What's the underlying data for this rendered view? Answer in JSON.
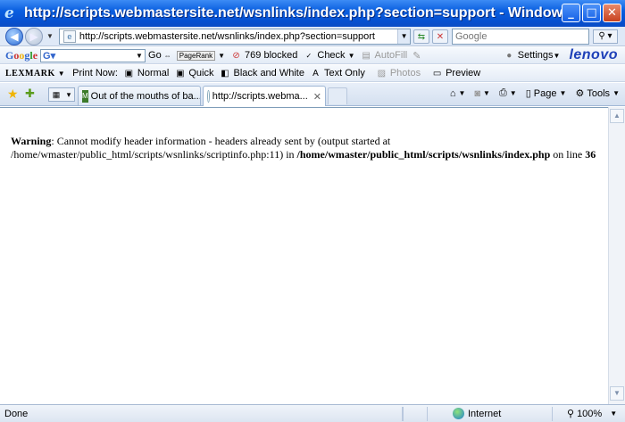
{
  "window": {
    "title": "http://scripts.webmastersite.net/wsnlinks/index.php?section=support - Windows In..."
  },
  "address_bar": {
    "url": "http://scripts.webmastersite.net/wsnlinks/index.php?section=support",
    "search_placeholder": "Google"
  },
  "google_toolbar": {
    "logo": "Google",
    "go_label": "Go",
    "pagerank_label": "PageRank",
    "blocked_label": "769 blocked",
    "check_label": "Check",
    "autofill_label": "AutoFill",
    "settings_label": "Settings",
    "brand": "lenovo"
  },
  "lexmark_toolbar": {
    "logo": "LEXMARK",
    "print_now_label": "Print Now:",
    "normal_label": "Normal",
    "quick_label": "Quick",
    "black_white_label": "Black and White",
    "text_only_label": "Text Only",
    "photos_label": "Photos",
    "preview_label": "Preview"
  },
  "tabs": [
    {
      "label": "Out of the mouths of ba...",
      "active": false
    },
    {
      "label": "http://scripts.webma...",
      "active": true
    }
  ],
  "command_bar": {
    "page_label": "Page",
    "tools_label": "Tools"
  },
  "content": {
    "warning_label": "Warning",
    "message_part1": ": Cannot modify header information - headers already sent by (output started at /home/wmaster/public_html/scripts/wsnlinks/scriptinfo.php:11) in ",
    "file_path": "/home/wmaster/public_html/scripts/wsnlinks/index.php",
    "on_line_label": " on line ",
    "line_number": "36"
  },
  "status_bar": {
    "status": "Done",
    "zone": "Internet",
    "zoom": "100%"
  },
  "colors": {
    "titlebar": "#0a5fe0",
    "brand": "#1d3fb8"
  }
}
